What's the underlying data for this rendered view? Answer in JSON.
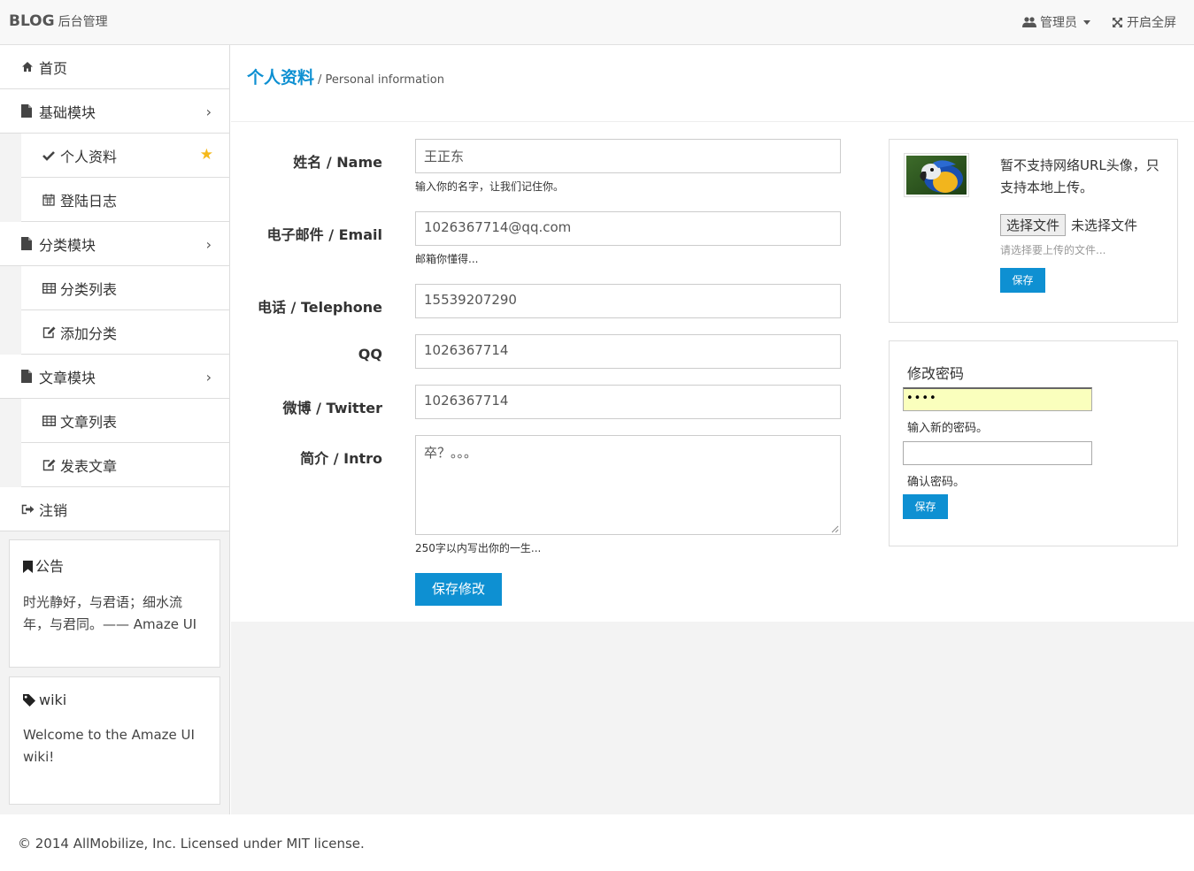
{
  "header": {
    "brand": "BLOG",
    "brand_sub": "后台管理",
    "user_menu": "管理员",
    "fullscreen": "开启全屏"
  },
  "sidebar": {
    "items": [
      {
        "label": "首页",
        "icon": "home-icon"
      },
      {
        "label": "基础模块",
        "icon": "file-icon"
      },
      {
        "label": "个人资料",
        "icon": "check-icon"
      },
      {
        "label": "登陆日志",
        "icon": "calendar-icon"
      },
      {
        "label": "分类模块",
        "icon": "file-icon"
      },
      {
        "label": "分类列表",
        "icon": "table-icon"
      },
      {
        "label": "添加分类",
        "icon": "edit-icon"
      },
      {
        "label": "文章模块",
        "icon": "file-icon"
      },
      {
        "label": "文章列表",
        "icon": "table-icon"
      },
      {
        "label": "发表文章",
        "icon": "edit-icon"
      },
      {
        "label": "注销",
        "icon": "signout-icon"
      }
    ],
    "notice": {
      "title": "公告",
      "text": "时光静好，与君语；细水流年，与君同。—— Amaze UI"
    },
    "wiki": {
      "title": "wiki",
      "text": "Welcome to the Amaze UI wiki!"
    }
  },
  "page": {
    "title": "个人资料",
    "subtitle": "/ Personal information"
  },
  "form": {
    "name_label": "姓名 / Name",
    "name_value": "王正东",
    "name_help": "输入你的名字，让我们记住你。",
    "email_label": "电子邮件 / Email",
    "email_value": "1026367714@qq.com",
    "email_help": "邮箱你懂得...",
    "phone_label": "电话 / Telephone",
    "phone_value": "15539207290",
    "qq_label": "QQ",
    "qq_value": "1026367714",
    "weibo_label": "微博 / Twitter",
    "weibo_value": "1026367714",
    "intro_label": "简介 / Intro",
    "intro_value": "卒？。。。",
    "intro_help": "250字以内写出你的一生...",
    "save_button": "保存修改"
  },
  "avatar_panel": {
    "notice": "暂不支持网络URL头像，只支持本地上传。",
    "choose_button": "选择文件",
    "no_file": "未选择文件",
    "help": "请选择要上传的文件...",
    "save_button": "保存"
  },
  "password_panel": {
    "title": "修改密码",
    "new_password_value": "••••",
    "new_help": "输入新的密码。",
    "confirm_help": "确认密码。",
    "save_button": "保存"
  },
  "footer": {
    "text": "© 2014 AllMobilize, Inc. Licensed under MIT license."
  },
  "colors": {
    "accent": "#0e90d2",
    "star": "#f5b91b",
    "autofill": "#faffbd"
  }
}
